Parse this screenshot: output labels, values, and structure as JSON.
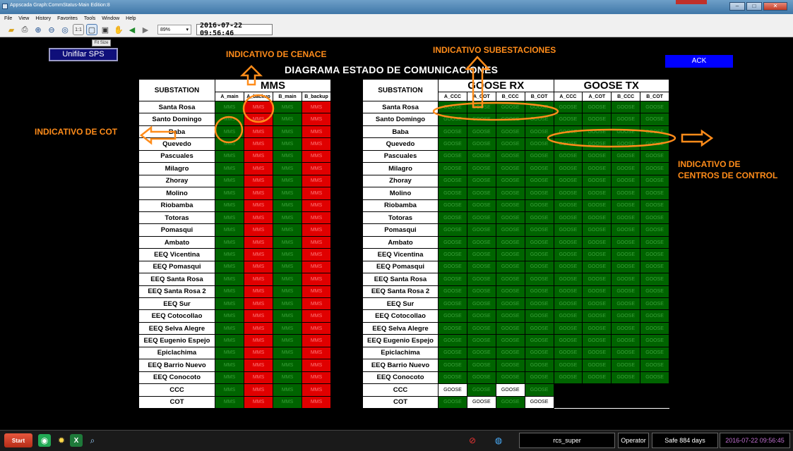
{
  "window": {
    "title": "Appscada Graph:CommStatus-Main Edition:8",
    "redtab_color": "#c0302a"
  },
  "menu": [
    "File",
    "View",
    "History",
    "Favorites",
    "Tools",
    "Window",
    "Help"
  ],
  "toolbar": {
    "zoom": "89%",
    "datetime": "2016-07-22 09:56:46",
    "tooltip": "Fit Size"
  },
  "buttons": {
    "unifilar": "Unifilar SPS",
    "ack": "ACK"
  },
  "diagram_title": "DIAGRAMA ESTADO DE COMUNICACIONES",
  "annotations": {
    "cenace": "INDICATIVO DE CENACE",
    "subestaciones": "INDICATIVO SUBESTACIONES",
    "cot": "INDICATIVO DE COT",
    "centros_line1": "INDICATIVO DE",
    "centros_line2": "CENTROS DE CONTROL"
  },
  "colors": {
    "ok": "#006400",
    "fail": "#e00000",
    "neutral": "#ffffff",
    "annotation": "#ff8c1a",
    "ack": "#0000ff"
  },
  "mms": {
    "group_label": "MMS",
    "station_header": "SUBSTATION",
    "columns": [
      "A_main",
      "A_backup",
      "B_main",
      "B_backup"
    ],
    "cell_text": "MMS",
    "rows": [
      {
        "name": "Santa Rosa",
        "s": [
          "g",
          "r",
          "g",
          "r"
        ]
      },
      {
        "name": "Santo Domingo",
        "s": [
          "g",
          "r",
          "g",
          "r"
        ]
      },
      {
        "name": "Baba",
        "s": [
          "g",
          "r",
          "g",
          "r"
        ]
      },
      {
        "name": "Quevedo",
        "s": [
          "g",
          "r",
          "g",
          "r"
        ]
      },
      {
        "name": "Pascuales",
        "s": [
          "g",
          "r",
          "g",
          "r"
        ]
      },
      {
        "name": "Milagro",
        "s": [
          "g",
          "r",
          "g",
          "r"
        ]
      },
      {
        "name": "Zhoray",
        "s": [
          "g",
          "r",
          "g",
          "r"
        ]
      },
      {
        "name": "Molino",
        "s": [
          "g",
          "r",
          "g",
          "r"
        ]
      },
      {
        "name": "Riobamba",
        "s": [
          "g",
          "r",
          "g",
          "r"
        ]
      },
      {
        "name": "Totoras",
        "s": [
          "g",
          "r",
          "g",
          "r"
        ]
      },
      {
        "name": "Pomasqui",
        "s": [
          "g",
          "r",
          "g",
          "r"
        ]
      },
      {
        "name": "Ambato",
        "s": [
          "g",
          "r",
          "g",
          "r"
        ]
      },
      {
        "name": "EEQ Vicentina",
        "s": [
          "g",
          "r",
          "g",
          "r"
        ]
      },
      {
        "name": "EEQ Pomasqui",
        "s": [
          "g",
          "r",
          "g",
          "r"
        ]
      },
      {
        "name": "EEQ Santa Rosa",
        "s": [
          "g",
          "r",
          "g",
          "r"
        ]
      },
      {
        "name": "EEQ Santa Rosa 2",
        "s": [
          "g",
          "r",
          "g",
          "r"
        ]
      },
      {
        "name": "EEQ Sur",
        "s": [
          "g",
          "r",
          "g",
          "r"
        ]
      },
      {
        "name": "EEQ Cotocollao",
        "s": [
          "g",
          "r",
          "g",
          "r"
        ]
      },
      {
        "name": "EEQ Selva Alegre",
        "s": [
          "g",
          "r",
          "g",
          "r"
        ]
      },
      {
        "name": "EEQ Eugenio Espejo",
        "s": [
          "g",
          "r",
          "g",
          "r"
        ]
      },
      {
        "name": "Epiclachima",
        "s": [
          "g",
          "r",
          "g",
          "r"
        ]
      },
      {
        "name": "EEQ Barrio Nuevo",
        "s": [
          "g",
          "r",
          "g",
          "r"
        ]
      },
      {
        "name": "EEQ Conocoto",
        "s": [
          "g",
          "r",
          "g",
          "r"
        ]
      },
      {
        "name": "CCC",
        "s": [
          "g",
          "r",
          "g",
          "r"
        ]
      },
      {
        "name": "COT",
        "s": [
          "g",
          "r",
          "g",
          "r"
        ]
      }
    ]
  },
  "goose": {
    "rx_label": "GOOSE RX",
    "tx_label": "GOOSE TX",
    "station_header": "SUBSTATION",
    "rx_columns": [
      "A_CCC",
      "A_COT",
      "B_CCC",
      "B_COT"
    ],
    "tx_columns": [
      "A_CCC",
      "A_COT",
      "B_CCC",
      "B_COT"
    ],
    "cell_text": "GOOSE",
    "rows": [
      {
        "name": "Santa Rosa",
        "s": [
          "g",
          "g",
          "g",
          "g",
          "g",
          "g",
          "g",
          "g"
        ]
      },
      {
        "name": "Santo Domingo",
        "s": [
          "g",
          "g",
          "g",
          "g",
          "g",
          "g",
          "g",
          "g"
        ]
      },
      {
        "name": "Baba",
        "s": [
          "g",
          "g",
          "g",
          "g",
          "g",
          "g",
          "g",
          "g"
        ]
      },
      {
        "name": "Quevedo",
        "s": [
          "g",
          "g",
          "g",
          "g",
          "g",
          "g",
          "g",
          "g"
        ]
      },
      {
        "name": "Pascuales",
        "s": [
          "g",
          "g",
          "g",
          "g",
          "g",
          "g",
          "g",
          "g"
        ]
      },
      {
        "name": "Milagro",
        "s": [
          "g",
          "g",
          "g",
          "g",
          "g",
          "g",
          "g",
          "g"
        ]
      },
      {
        "name": "Zhoray",
        "s": [
          "g",
          "g",
          "g",
          "g",
          "g",
          "g",
          "g",
          "g"
        ]
      },
      {
        "name": "Molino",
        "s": [
          "g",
          "g",
          "g",
          "g",
          "g",
          "g",
          "g",
          "g"
        ]
      },
      {
        "name": "Riobamba",
        "s": [
          "g",
          "g",
          "g",
          "g",
          "g",
          "g",
          "g",
          "g"
        ]
      },
      {
        "name": "Totoras",
        "s": [
          "g",
          "g",
          "g",
          "g",
          "g",
          "g",
          "g",
          "g"
        ]
      },
      {
        "name": "Pomasqui",
        "s": [
          "g",
          "g",
          "g",
          "g",
          "g",
          "g",
          "g",
          "g"
        ]
      },
      {
        "name": "Ambato",
        "s": [
          "g",
          "g",
          "g",
          "g",
          "g",
          "g",
          "g",
          "g"
        ]
      },
      {
        "name": "EEQ Vicentina",
        "s": [
          "g",
          "g",
          "g",
          "g",
          "g",
          "g",
          "g",
          "g"
        ]
      },
      {
        "name": "EEQ Pomasqui",
        "s": [
          "g",
          "g",
          "g",
          "g",
          "g",
          "g",
          "g",
          "g"
        ]
      },
      {
        "name": "EEQ Santa Rosa",
        "s": [
          "g",
          "g",
          "g",
          "g",
          "g",
          "g",
          "g",
          "g"
        ]
      },
      {
        "name": "EEQ Santa Rosa 2",
        "s": [
          "g",
          "g",
          "g",
          "g",
          "g",
          "g",
          "g",
          "g"
        ]
      },
      {
        "name": "EEQ Sur",
        "s": [
          "g",
          "g",
          "g",
          "g",
          "g",
          "g",
          "g",
          "g"
        ]
      },
      {
        "name": "EEQ Cotocollao",
        "s": [
          "g",
          "g",
          "g",
          "g",
          "g",
          "g",
          "g",
          "g"
        ]
      },
      {
        "name": "EEQ Selva Alegre",
        "s": [
          "g",
          "g",
          "g",
          "g",
          "g",
          "g",
          "g",
          "g"
        ]
      },
      {
        "name": "EEQ Eugenio Espejo",
        "s": [
          "g",
          "g",
          "g",
          "g",
          "g",
          "g",
          "g",
          "g"
        ]
      },
      {
        "name": "Epiclachima",
        "s": [
          "g",
          "g",
          "g",
          "g",
          "g",
          "g",
          "g",
          "g"
        ]
      },
      {
        "name": "EEQ Barrio Nuevo",
        "s": [
          "g",
          "g",
          "g",
          "g",
          "g",
          "g",
          "g",
          "g"
        ]
      },
      {
        "name": "EEQ Conocoto",
        "s": [
          "g",
          "g",
          "g",
          "g",
          "g",
          "g",
          "g",
          "g"
        ]
      },
      {
        "name": "CCC",
        "s": [
          "w",
          "g",
          "w",
          "g",
          "-",
          "-",
          "-",
          "-"
        ]
      },
      {
        "name": "COT",
        "s": [
          "g",
          "w",
          "g",
          "w",
          "-",
          "-",
          "-",
          "-"
        ]
      }
    ]
  },
  "taskbar": {
    "start": "Start",
    "user": "rcs_super",
    "role": "Operator",
    "safe": "Safe 884 days",
    "clock": "2016-07-22 09:56:45"
  }
}
